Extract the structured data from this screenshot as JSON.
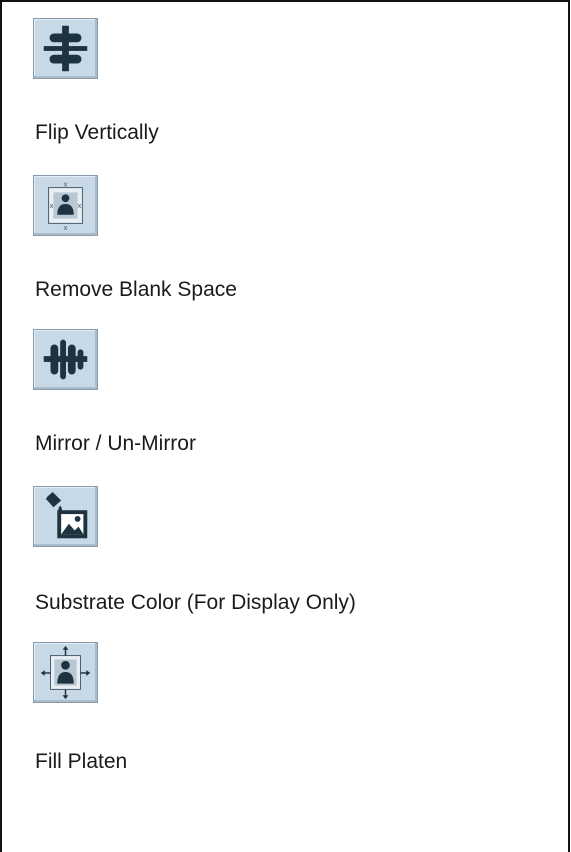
{
  "tools": [
    {
      "label": "Flip Vertically",
      "icon": "flip-vertically-icon"
    },
    {
      "label": "Remove Blank Space",
      "icon": "remove-blank-space-icon"
    },
    {
      "label": "Mirror / Un-Mirror",
      "icon": "mirror-icon"
    },
    {
      "label": "Substrate Color (For Display Only)",
      "icon": "substrate-color-icon"
    },
    {
      "label": "Fill Platen",
      "icon": "fill-platen-icon"
    }
  ],
  "colors": {
    "button_bg": "#c7d8e6",
    "icon_dark": "#1e3340",
    "frame": "#111111"
  }
}
